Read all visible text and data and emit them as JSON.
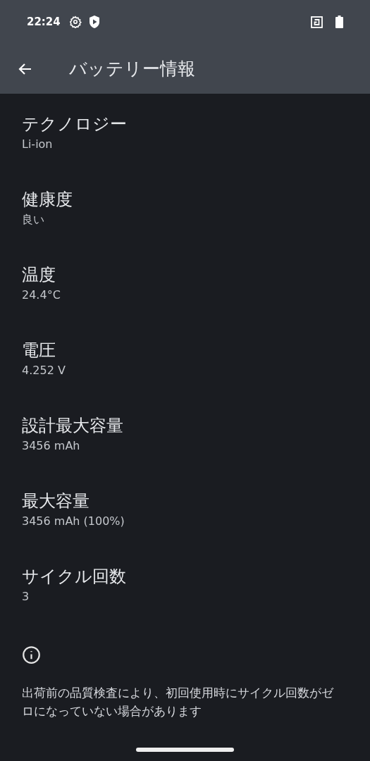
{
  "status_bar": {
    "time": "22:24"
  },
  "app_bar": {
    "title": "バッテリー情報"
  },
  "items": [
    {
      "title": "テクノロジー",
      "value": "Li-ion"
    },
    {
      "title": "健康度",
      "value": "良い"
    },
    {
      "title": "温度",
      "value": "24.4°C"
    },
    {
      "title": "電圧",
      "value": "4.252 V"
    },
    {
      "title": "設計最大容量",
      "value": "3456 mAh"
    },
    {
      "title": "最大容量",
      "value": "3456 mAh (100%)"
    },
    {
      "title": "サイクル回数",
      "value": "3"
    }
  ],
  "note": "出荷前の品質検査により、初回使用時にサイクル回数がゼロになっていない場合があります"
}
